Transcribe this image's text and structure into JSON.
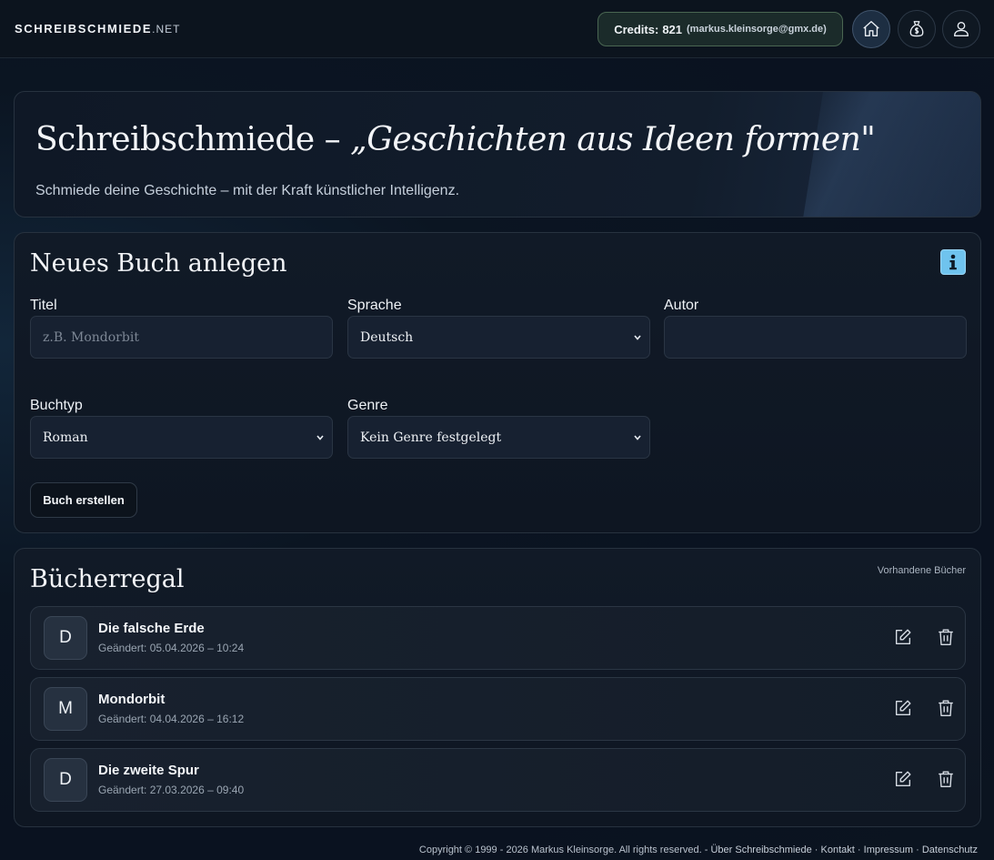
{
  "header": {
    "brand": "SCHREIBSCHMIEDE",
    "brand_tld": ".NET",
    "credits_label": "Credits:",
    "credits_value": "821",
    "credits_email": "(markus.kleinsorge@gmx.de)",
    "icons": [
      "home-icon",
      "money-bag-icon",
      "user-icon"
    ]
  },
  "hero": {
    "title_plain": "Schreibschmiede – ",
    "title_italic": "„Geschichten aus Ideen formen\"",
    "subtitle": "Schmiede deine Geschichte – mit der Kraft künstlicher Intelligenz."
  },
  "new_book": {
    "title": "Neues Buch anlegen",
    "info_icon": "info-icon",
    "title_label": "Titel",
    "title_placeholder": "z.B. Mondorbit",
    "language_label": "Sprache",
    "language_value": "Deutsch",
    "author_label": "Autor",
    "author_value": "",
    "booktype_label": "Buchtyp",
    "booktype_value": "Roman",
    "genre_label": "Genre",
    "genre_value": "Kein Genre festgelegt",
    "create_button": "Buch erstellen"
  },
  "shelf": {
    "title": "Bücherregal",
    "subtitle": "Vorhandene Bücher",
    "books": [
      {
        "initial": "D",
        "title": "Die falsche Erde",
        "changed": "Geändert: 05.04.2026 – 10:24"
      },
      {
        "initial": "M",
        "title": "Mondorbit",
        "changed": "Geändert: 04.04.2026 – 16:12"
      },
      {
        "initial": "D",
        "title": "Die zweite Spur",
        "changed": "Geändert: 27.03.2026 – 09:40"
      }
    ]
  },
  "footer": {
    "copyright": "Copyright © 1999 - 2026 Markus Kleinsorge. All rights reserved. -",
    "links": [
      "Über Schreibschmiede",
      "Kontakt",
      "Impressum",
      "Datenschutz"
    ],
    "separator": "·"
  }
}
